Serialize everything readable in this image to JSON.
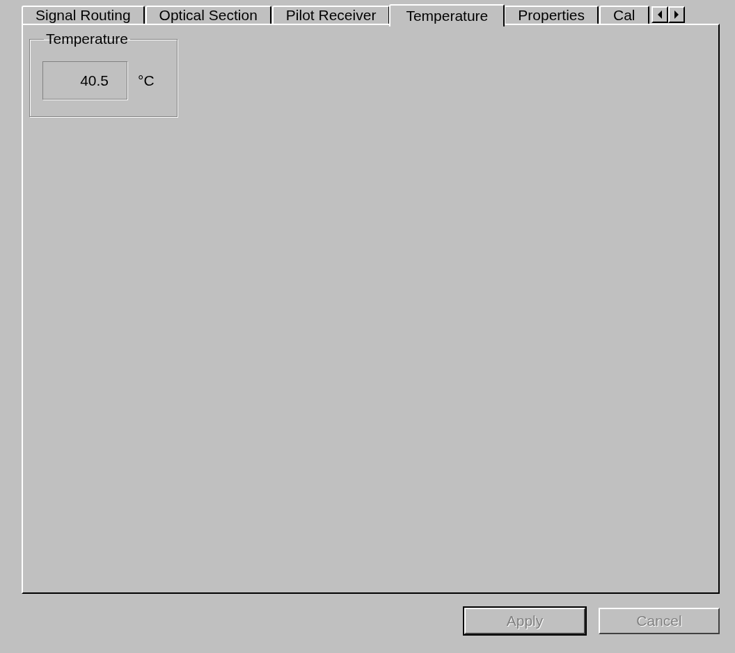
{
  "tabs": [
    {
      "label": "Signal Routing",
      "selected": false
    },
    {
      "label": "Optical Section",
      "selected": false
    },
    {
      "label": "Pilot Receiver",
      "selected": false
    },
    {
      "label": "Temperature",
      "selected": true
    },
    {
      "label": "Properties",
      "selected": false
    },
    {
      "label": "Cal",
      "selected": false
    }
  ],
  "temperature_group": {
    "title": "Temperature",
    "value": "40.5",
    "unit": "°C"
  },
  "buttons": [
    {
      "label": "Apply",
      "disabled": true
    },
    {
      "label": "Cancel",
      "disabled": true
    }
  ]
}
